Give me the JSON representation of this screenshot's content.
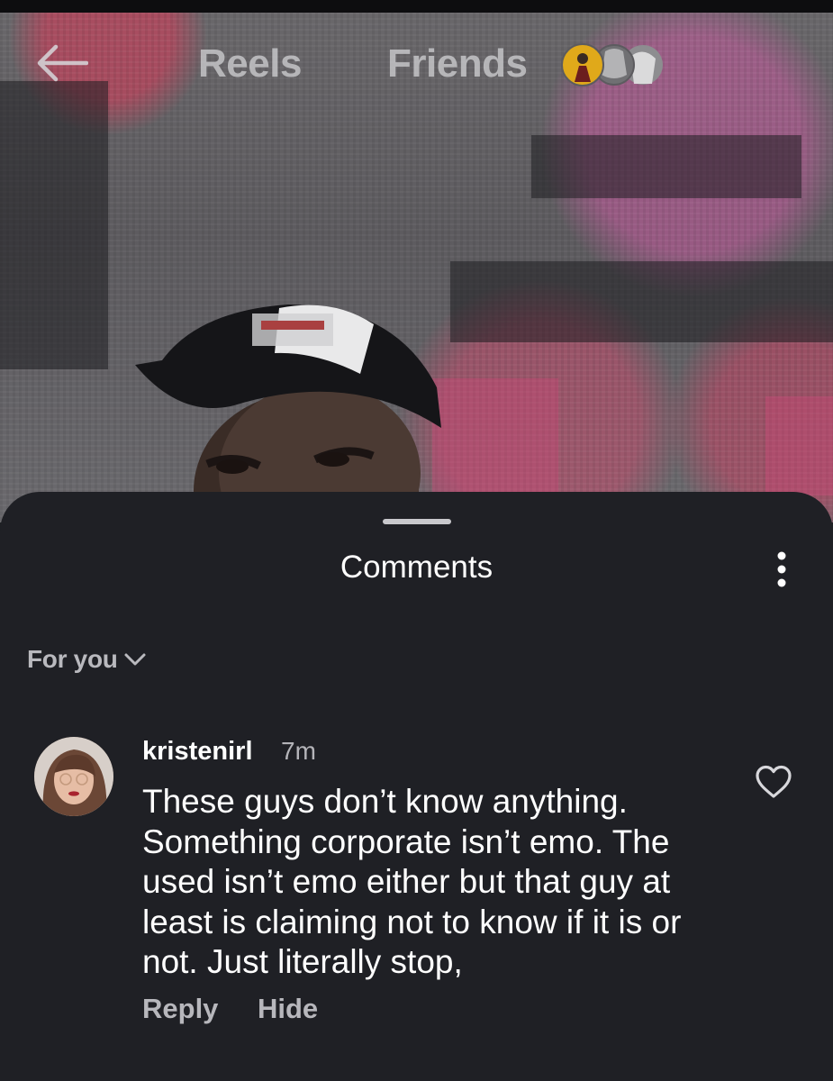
{
  "header": {
    "tabs": [
      "Reels",
      "Friends"
    ]
  },
  "comments_sheet": {
    "title": "Comments",
    "filter_label": "For you",
    "comment": {
      "username": "kristenirl",
      "time": "7m",
      "text": "These guys don’t know anything. Something corporate isn’t emo. The used isn’t emo either but that guy at least is claiming not to know if it is or not. Just literally stop,",
      "actions": [
        "Reply",
        "Hide"
      ]
    }
  },
  "icons": {
    "back": "arrow-left-icon",
    "menu": "more-vertical-icon",
    "chevron": "chevron-down-icon",
    "like": "heart-outline-icon"
  },
  "colors": {
    "sheet_bg": "#1f2025",
    "text_primary": "#ffffff",
    "text_secondary": "#b7b7bc"
  }
}
